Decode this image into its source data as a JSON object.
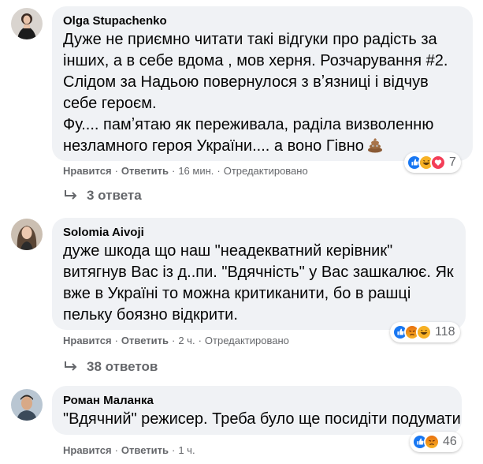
{
  "comments": [
    {
      "author": "Olga Stupachenko",
      "lines": [
        "Дуже не приємно читати такі відгуки про радість за",
        "інших, а в себе вдома , мов херня. Розчарування #2.",
        "Слідом за Надьою повернулося з вʼязниці і відчув",
        "себе героєм.",
        "Фу.... памʼятаю як переживала, раділа визволенню",
        "незламного героя України.... а воно Гівно"
      ],
      "like_label": "Нравится",
      "reply_label": "Ответить",
      "time": "16 мин.",
      "edited": "Отредактировано",
      "reaction_count": "7",
      "reactions": [
        "like-icon",
        "haha-icon",
        "love-icon"
      ],
      "replies_label": "3 ответа"
    },
    {
      "author": "Solomia Aivoji",
      "lines": [
        "дуже шкода що наш \"неадекватний керівник\"",
        "витягнув Вас із д..пи. \"Вдячність\" у Вас зашкалює. Як",
        "вже в Україні то можна критиканити, бо в рашці",
        "пельку боязно відкрити."
      ],
      "like_label": "Нравится",
      "reply_label": "Ответить",
      "time": "2 ч.",
      "edited": "Отредактировано",
      "reaction_count": "118",
      "reactions": [
        "like-icon",
        "angry-icon",
        "haha-icon"
      ],
      "replies_label": "38 ответов"
    },
    {
      "author": "Роман Маланка",
      "lines": [
        "\"Вдячний\" режисер. Треба було ще посидіти подумати"
      ],
      "like_label": "Нравится",
      "reply_label": "Ответить",
      "time": "1 ч.",
      "reaction_count": "46",
      "reactions": [
        "like-icon",
        "angry-icon"
      ]
    }
  ],
  "colors": {
    "bubble": "#f0f2f5",
    "meta_text": "#65676b",
    "like_blue": "#1877f2",
    "haha_yellow": "#f7b125",
    "love_red": "#f33e58",
    "angry_orange": "#e9710f"
  }
}
